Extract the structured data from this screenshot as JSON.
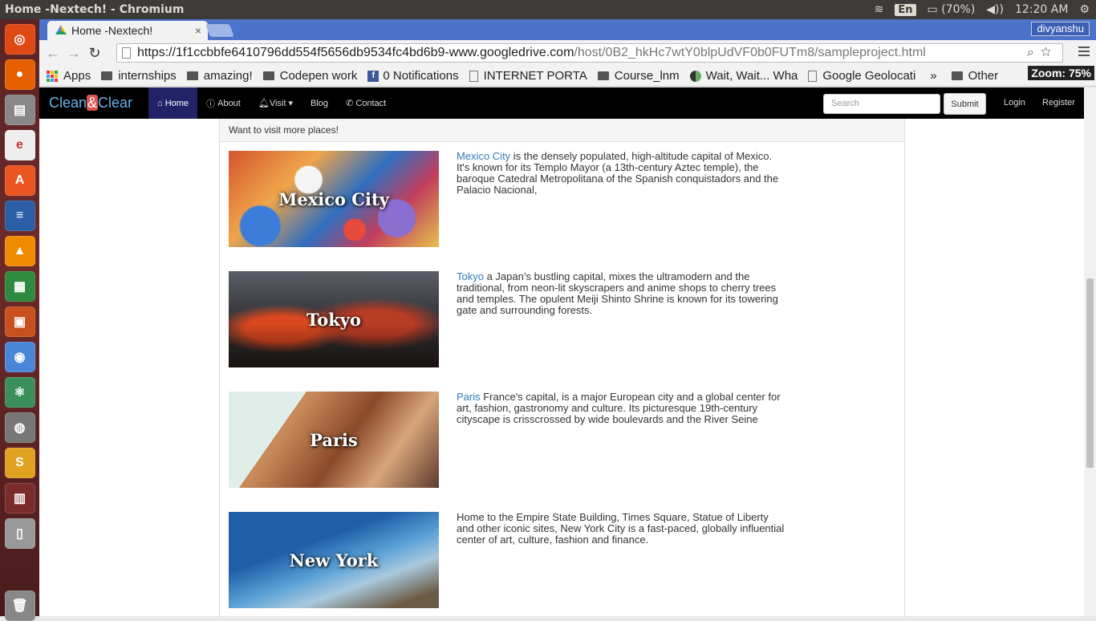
{
  "os": {
    "window_title": "Home -Nextech! - Chromium",
    "language": "En",
    "battery": "(70%)",
    "time": "12:20 AM"
  },
  "browser": {
    "tab_title": "Home -Nextech!",
    "tab_close": "×",
    "user": "divyanshu",
    "url_main": "https://1f1ccbbfe6410796dd554f5656db9534fc4bd6b9-www.googledrive.com",
    "url_path": "/host/0B2_hkHc7wtY0blpUdVF0b0FUTm8/sampleproject.html",
    "zoom": "Zoom: 75%",
    "bookmarks": [
      {
        "label": "Apps",
        "icon": "apps-grid-icon"
      },
      {
        "label": "internships",
        "icon": "folder-icon"
      },
      {
        "label": "amazing!",
        "icon": "folder-icon"
      },
      {
        "label": "Codepen work",
        "icon": "folder-icon"
      },
      {
        "label": "0 Notifications",
        "icon": "facebook-icon"
      },
      {
        "label": "INTERNET PORTA",
        "icon": "page-icon"
      },
      {
        "label": "Course_lnm",
        "icon": "folder-icon"
      },
      {
        "label": "Wait, Wait... Wha",
        "icon": "globe-icon"
      },
      {
        "label": "Google Geolocati",
        "icon": "page-icon"
      },
      {
        "label": "»",
        "icon": ""
      },
      {
        "label": "Other",
        "icon": "folder-icon"
      }
    ]
  },
  "site": {
    "brand_left": "Clean",
    "brand_amp": "&",
    "brand_right": "Clear",
    "nav": {
      "home": "Home",
      "about": "About",
      "visit": "Visit",
      "blog": "Blog",
      "contact": "Contact"
    },
    "search_placeholder": "Search",
    "submit": "Submit",
    "login": "Login",
    "register": "Register",
    "panel_heading": "Want to visit more places!",
    "places": [
      {
        "image_label": "Mexico City",
        "link": "Mexico City",
        "text": " is the densely populated, high-altitude capital of Mexico. It's known for its Templo Mayor (a 13th-century Aztec temple), the baroque Catedral Metropolitana of the Spanish conquistadors and the Palacio Nacional,"
      },
      {
        "image_label": "Tokyo",
        "link": "Tokyo",
        "text": " a Japan’s bustling capital, mixes the ultramodern and the traditional, from neon-lit skyscrapers and anime shops to cherry trees and temples. The opulent Meiji Shinto Shrine is known for its towering gate and surrounding forests."
      },
      {
        "image_label": "Paris",
        "link": "Paris",
        "text": " France's capital, is a major European city and a global center for art, fashion, gastronomy and culture. Its picturesque 19th-century cityscape is crisscrossed by wide boulevards and the River Seine"
      },
      {
        "image_label": "New York",
        "link": "",
        "text": "Home to the Empire State Building, Times Square, Statue of Liberty and other iconic sites, New York City is a fast-paced, globally influential center of art, culture, fashion and finance."
      }
    ]
  }
}
